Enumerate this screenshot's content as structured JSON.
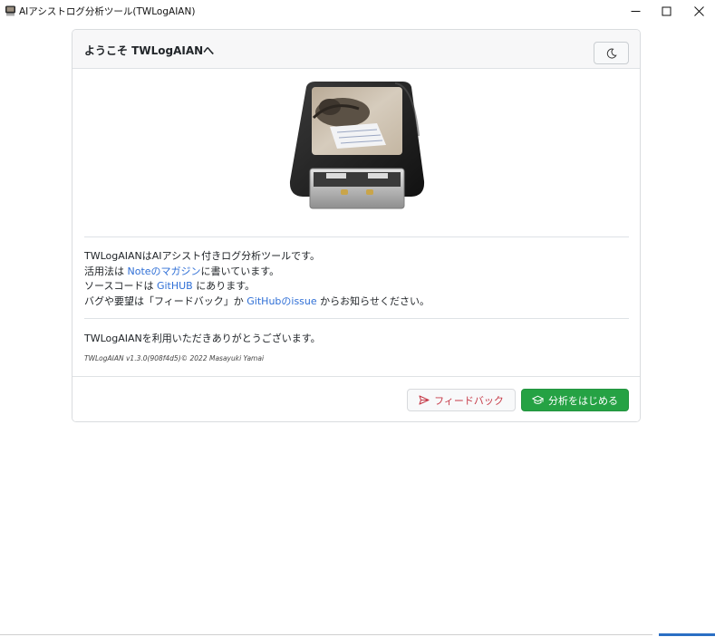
{
  "window": {
    "title": "AIアシストログ分析ツール(TWLogAIAN)",
    "icon": "usb-drive-icon"
  },
  "card": {
    "header_title": "ようこそ TWLogAIANへ",
    "theme_toggle_icon": "moon-icon"
  },
  "description": {
    "line1": "TWLogAIANはAIアシスト付きログ分析ツールです。",
    "line2_prefix": "活用法は ",
    "line2_link": "Noteのマガジン",
    "line2_suffix": "に書いています。",
    "line3_prefix": "ソースコードは ",
    "line3_link": "GitHUB",
    "line3_suffix": " にあります。",
    "line4_prefix": "バグや要望は「フィードバック」か ",
    "line4_link": "GitHubのissue",
    "line4_suffix": " からお知らせください。"
  },
  "thanks": "TWLogAIANを利用いただきありがとうございます。",
  "version": "TWLogAIAN v1.3.0(908f4d5)© 2022 Masayuki Yamai",
  "footer": {
    "feedback_label": "フィードバック",
    "start_label": "分析をはじめる"
  },
  "colors": {
    "link": "#2f6fd6",
    "success": "#25a244",
    "danger": "#c63a48"
  }
}
